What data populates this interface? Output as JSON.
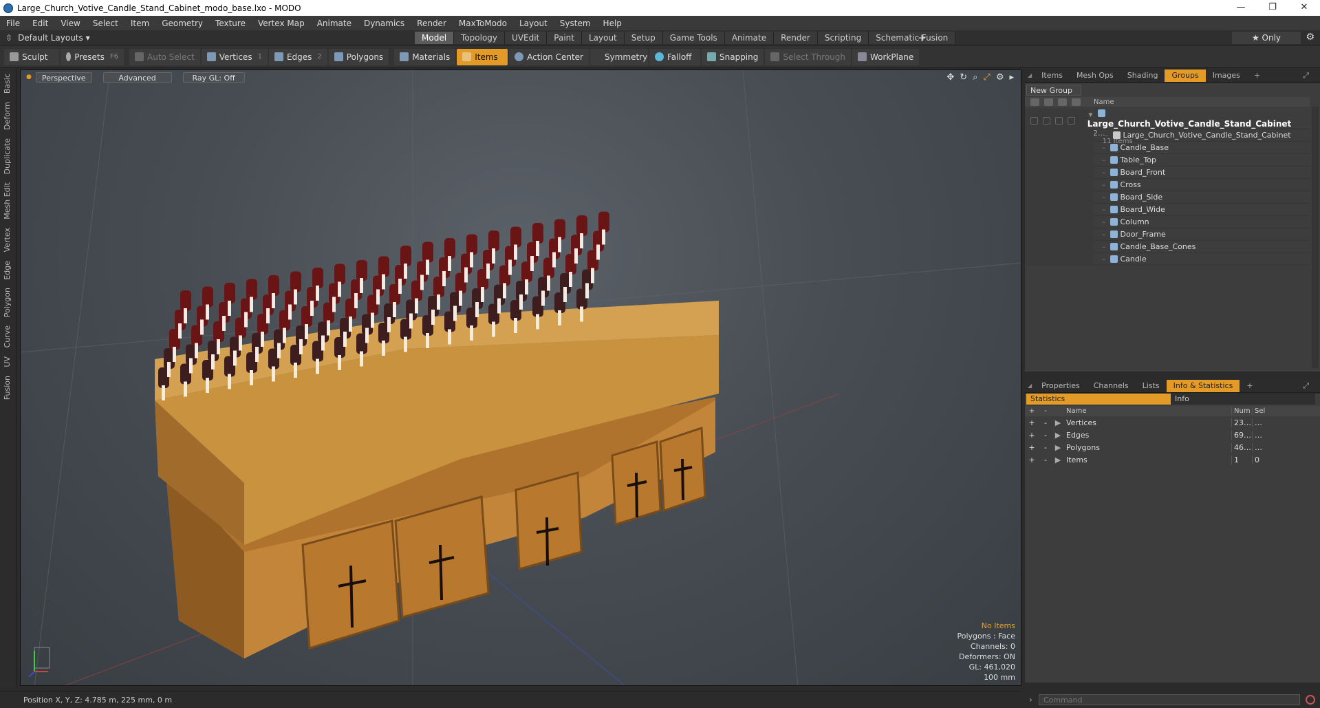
{
  "window": {
    "title": "Large_Church_Votive_Candle_Stand_Cabinet_modo_base.lxo - MODO",
    "minimize": "—",
    "restore": "❐",
    "close": "✕"
  },
  "menu": [
    "File",
    "Edit",
    "View",
    "Select",
    "Item",
    "Geometry",
    "Texture",
    "Vertex Map",
    "Animate",
    "Dynamics",
    "Render",
    "MaxToModo",
    "Layout",
    "System",
    "Help"
  ],
  "layout": {
    "preset": "Default Layouts ▾",
    "tabs": [
      "Model",
      "Topology",
      "UVEdit",
      "Paint",
      "Layout",
      "Setup",
      "Game Tools",
      "Animate",
      "Render",
      "Scripting",
      "Schematic Fusion"
    ],
    "active_tab": "Model",
    "add": "+",
    "only": "★  Only"
  },
  "toolbar": {
    "sculpt": "Sculpt",
    "presets": "Presets",
    "presets_key": "F6",
    "auto_select": "Auto Select",
    "vertices": "Vertices",
    "vertices_count": "1",
    "edges": "Edges",
    "edges_count": "2",
    "polygons": "Polygons",
    "materials": "Materials",
    "items": "Items",
    "action_center": "Action Center",
    "symmetry": "Symmetry",
    "falloff": "Falloff",
    "snapping": "Snapping",
    "select_through": "Select Through",
    "workplane": "WorkPlane"
  },
  "left_tabs": [
    "Basic",
    "Deform",
    "Duplicate",
    "Mesh Edit",
    "Vertex",
    "Edge",
    "Polygon",
    "Curve",
    "UV",
    "Fusion"
  ],
  "viewport": {
    "view": "Perspective",
    "shading": "Advanced",
    "raygl": "Ray GL: Off",
    "hud": {
      "items": "No Items",
      "polygons": "Polygons : Face",
      "channels": "Channels: 0",
      "deformers": "Deformers: ON",
      "gl": "GL: 461,020",
      "scale": "100 mm"
    }
  },
  "groups_panel": {
    "tabs": [
      "Items",
      "Mesh Ops",
      "Shading",
      "Groups",
      "Images"
    ],
    "active": "Groups",
    "new_group": "New Group",
    "name_header": "Name",
    "group_name": "Large_Church_Votive_Candle_Stand_Cabinet",
    "group_suffix": "(2...",
    "group_count": "11 Items",
    "items": [
      "Large_Church_Votive_Candle_Stand_Cabinet",
      "Candle_Base",
      "Table_Top",
      "Board_Front",
      "Cross",
      "Board_Side",
      "Board_Wide",
      "Column",
      "Door_Frame",
      "Candle_Base_Cones",
      "Candle"
    ]
  },
  "props_panel": {
    "tabs": [
      "Properties",
      "Channels",
      "Lists",
      "Info & Statistics"
    ],
    "active": "Info & Statistics",
    "sub_tabs": [
      "Statistics",
      "Info"
    ],
    "headers": {
      "name": "Name",
      "num": "Num",
      "sel": "Sel"
    },
    "rows": [
      {
        "name": "Vertices",
        "num": "23…",
        "sel": "…"
      },
      {
        "name": "Edges",
        "num": "69…",
        "sel": "…"
      },
      {
        "name": "Polygons",
        "num": "46…",
        "sel": "…"
      },
      {
        "name": "Items",
        "num": "1",
        "sel": "0"
      }
    ]
  },
  "status": {
    "position": "Position X, Y, Z:  4.785 m, 225 mm, 0 m"
  },
  "command": {
    "placeholder": "Command"
  }
}
